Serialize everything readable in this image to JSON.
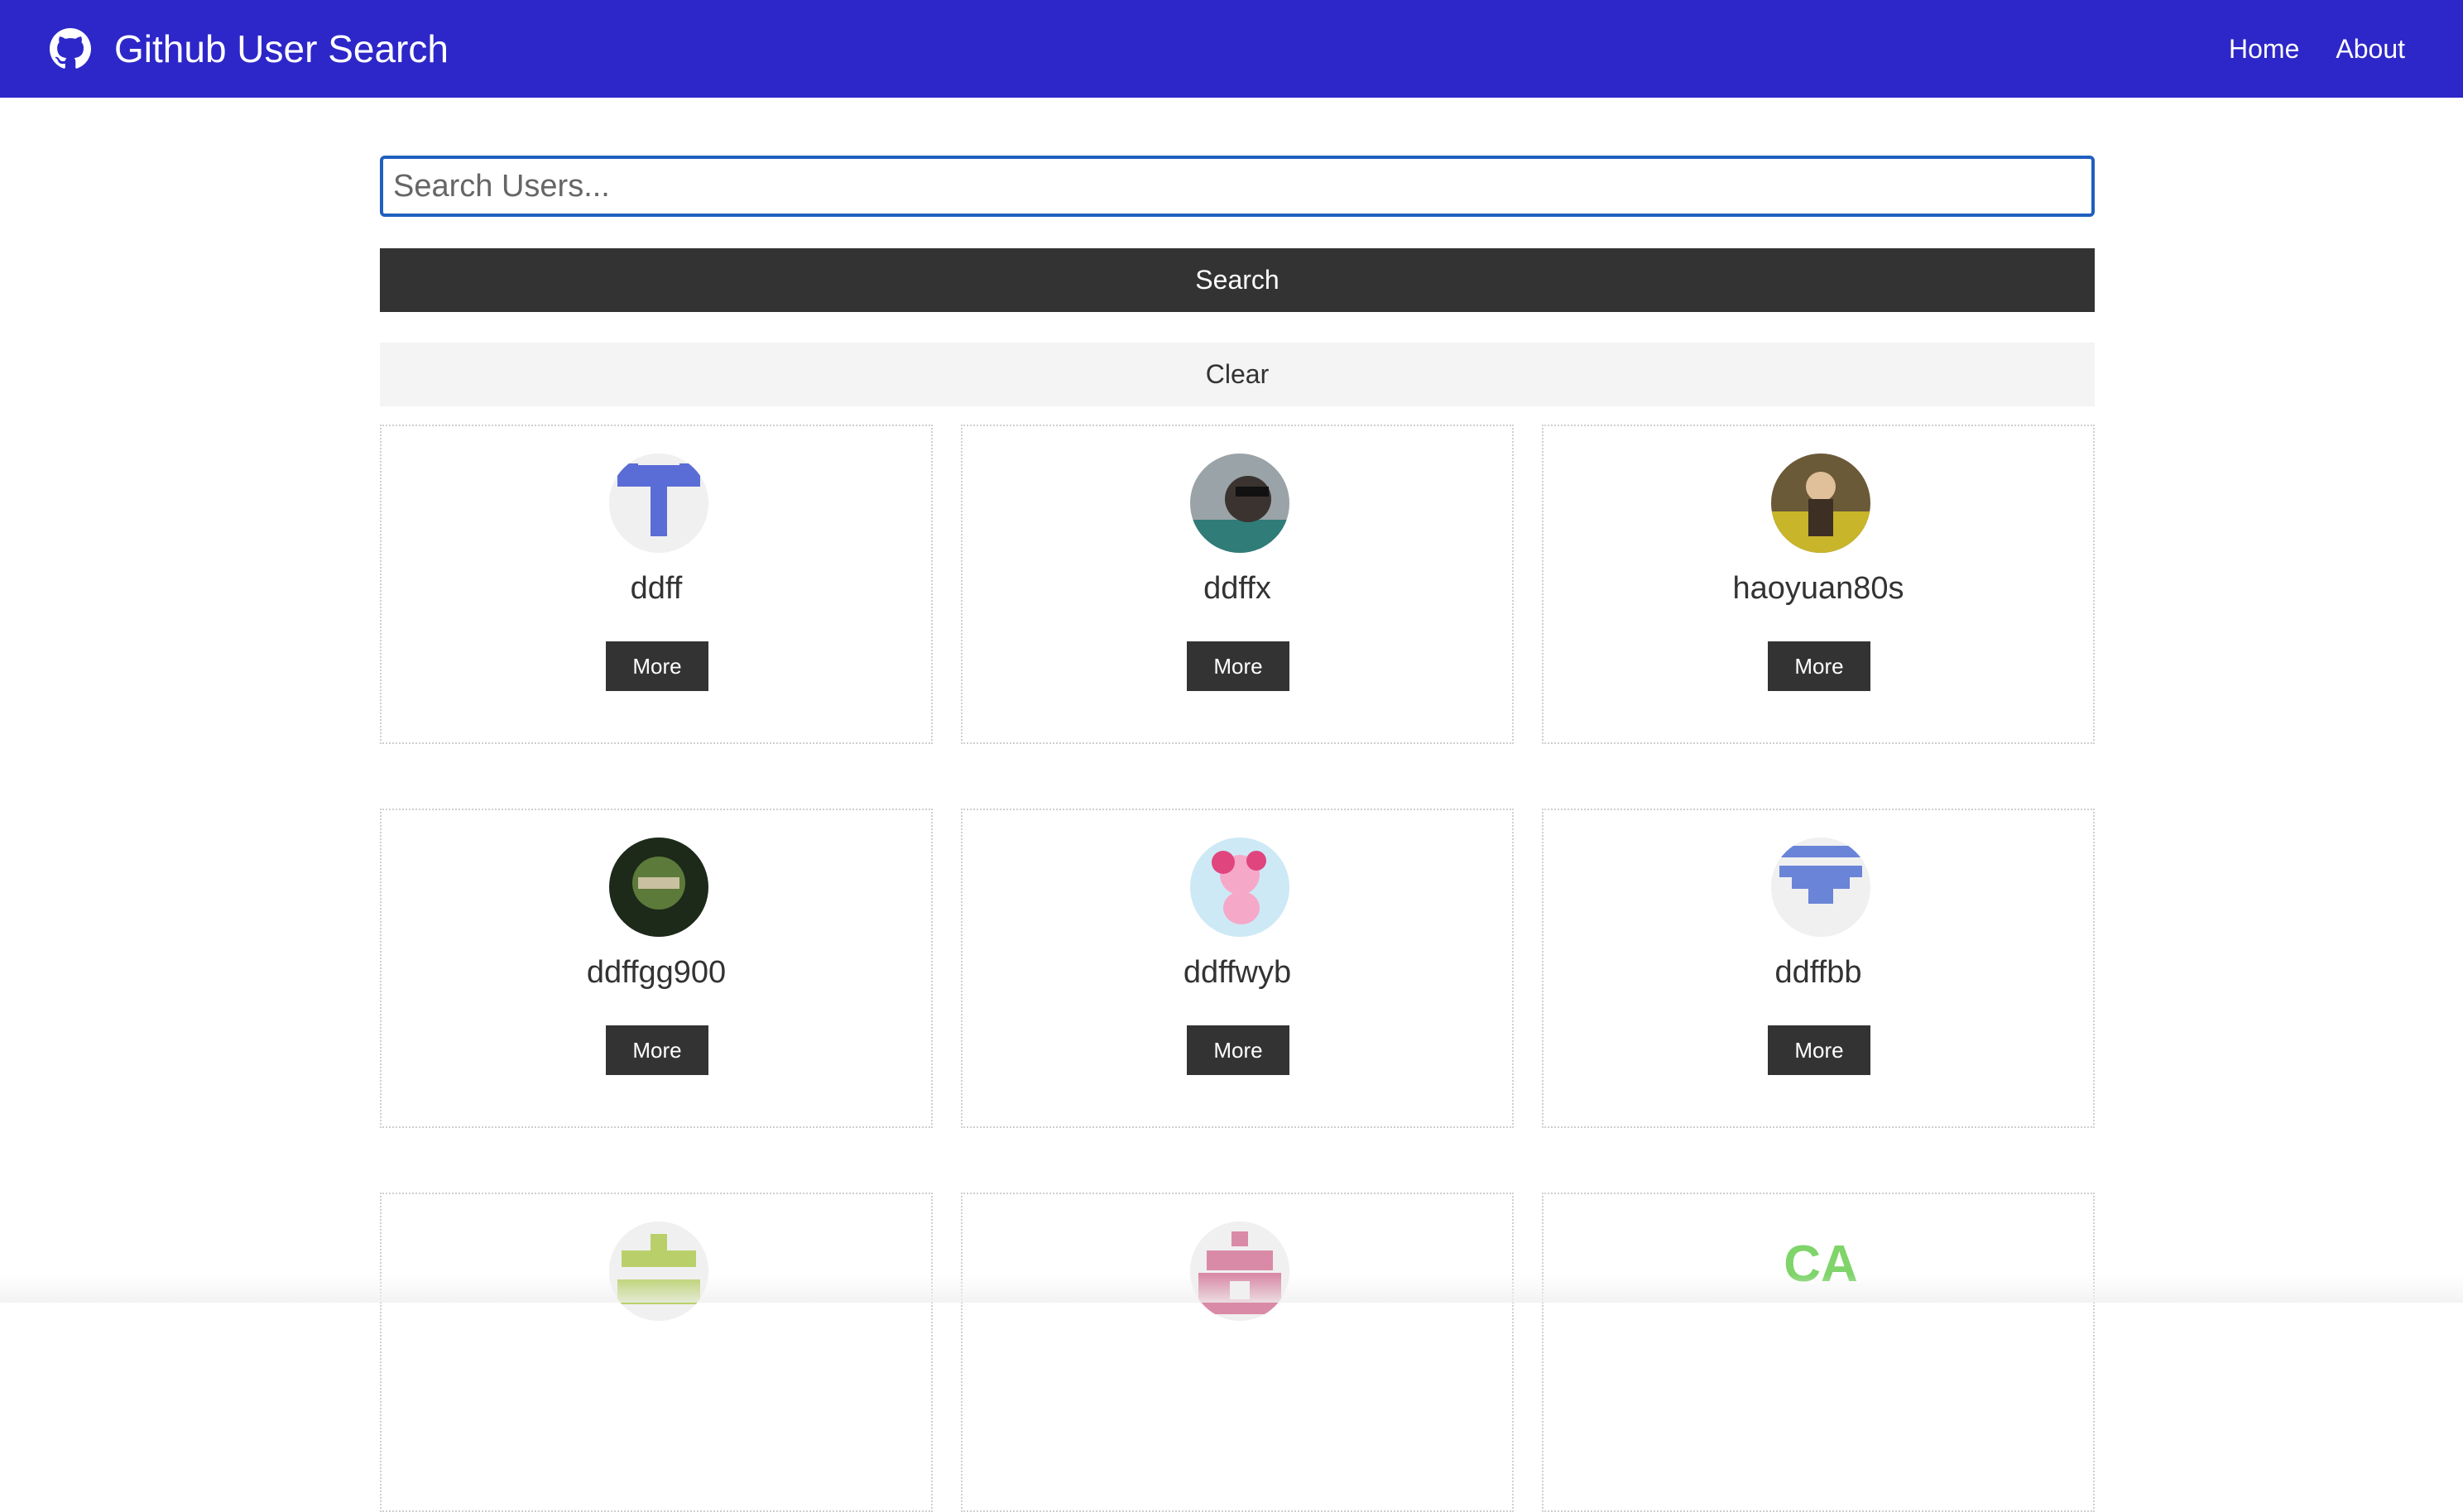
{
  "navbar": {
    "title": "Github User Search",
    "icon": "github-icon",
    "links": [
      {
        "label": "Home"
      },
      {
        "label": "About"
      }
    ],
    "bg_color": "#2d27c9"
  },
  "search": {
    "placeholder": "Search Users...",
    "value": "",
    "search_label": "Search",
    "clear_label": "Clear"
  },
  "users": [
    {
      "login": "ddff",
      "more_label": "More",
      "avatar": "identicon-blue"
    },
    {
      "login": "ddffx",
      "more_label": "More",
      "avatar": "photo-portrait"
    },
    {
      "login": "haoyuan80s",
      "more_label": "More",
      "avatar": "photo-figure"
    },
    {
      "login": "ddffgg900",
      "more_label": "More",
      "avatar": "photo-soldier"
    },
    {
      "login": "ddffwyb",
      "more_label": "More",
      "avatar": "pony-cartoon"
    },
    {
      "login": "ddffbb",
      "more_label": "More",
      "avatar": "identicon-blue"
    },
    {
      "login": "",
      "more_label": "",
      "avatar": "identicon-green"
    },
    {
      "login": "",
      "more_label": "",
      "avatar": "identicon-pink"
    },
    {
      "login": "",
      "more_label": "",
      "avatar": "text-logo",
      "avatar_text": "CA"
    }
  ],
  "colors": {
    "accent": "#2d27c9",
    "button_dark": "#333333",
    "button_light": "#f4f4f4"
  }
}
